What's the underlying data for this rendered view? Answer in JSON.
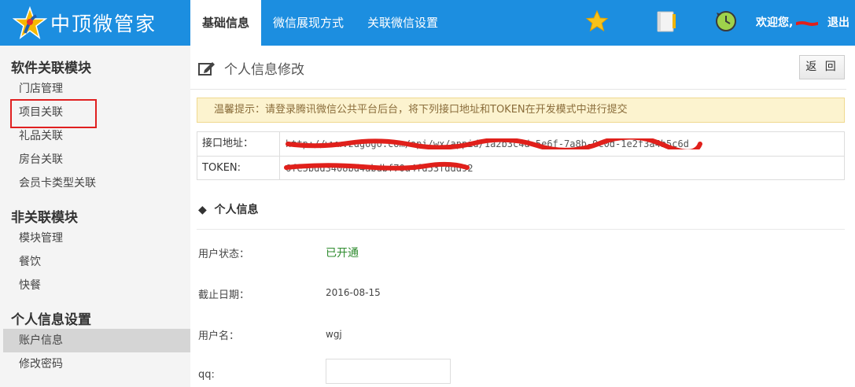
{
  "app": {
    "logo_text": "中顶微管家"
  },
  "nav": {
    "tabs": [
      {
        "label": "基础信息",
        "active": true
      },
      {
        "label": "微信展现方式",
        "active": false
      },
      {
        "label": "关联微信设置",
        "active": false
      }
    ]
  },
  "header": {
    "icons": [
      "star-icon",
      "notebook-icon",
      "history-icon"
    ],
    "welcome": "欢迎您,",
    "logout": "退出"
  },
  "sidebar": {
    "sections": [
      {
        "title": "软件关联模块",
        "items": [
          "门店管理",
          "项目关联",
          "礼品关联",
          "房台关联",
          "会员卡类型关联"
        ]
      },
      {
        "title": "非关联模块",
        "items": [
          "模块管理",
          "餐饮",
          "快餐"
        ]
      },
      {
        "title": "个人信息设置",
        "items": [
          "账户信息",
          "修改密码"
        ]
      }
    ],
    "active_item": "账户信息",
    "highlighted_item": "项目关联"
  },
  "page": {
    "title": "个人信息修改",
    "back_button": "返 回",
    "tip": "温馨提示：请登录腾讯微信公共平台后台，将下列接口地址和TOKEN在开发模式中进行提交",
    "interface": {
      "url_label": "接口地址：",
      "url_value": "http://www.zdgogo.com/api/wx/appid/1a2b3c4d-5e6f-7a8b-9c0d-1e2f3a4b5c6d",
      "token_label": "TOKEN:",
      "token_value": "6fe5bdd3408bd4abdbf70a4fd53fddd92"
    },
    "section_title": "个人信息",
    "fields": {
      "status_label": "用户状态：",
      "status_value": "已开通",
      "expiry_label": "截止日期：",
      "expiry_value": "2016-08-15",
      "username_label": "用户名：",
      "username_value": "wgj",
      "qq_label": "qq:",
      "qq_value": ""
    }
  },
  "colors": {
    "topbar": "#1c8ee0",
    "sidebar_bg": "#f4f4f4",
    "tip_bg": "#fcf3cf",
    "status_green": "#2e8b2e",
    "redaction_red": "#e0201b"
  }
}
